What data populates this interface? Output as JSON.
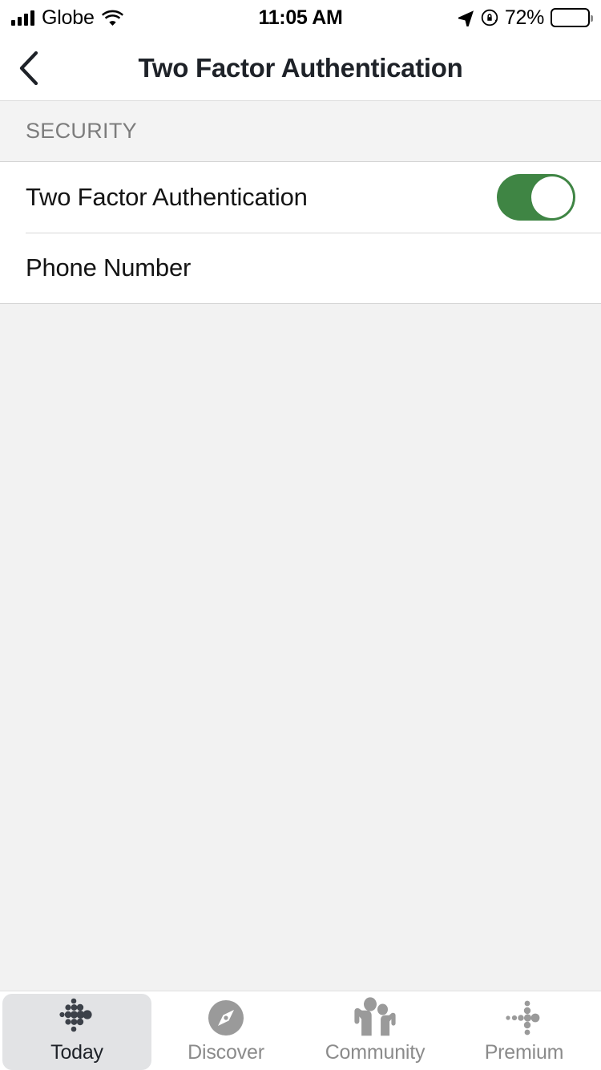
{
  "status_bar": {
    "carrier": "Globe",
    "signal_icon": "signal-bars-icon",
    "wifi_icon": "wifi-icon",
    "time": "11:05 AM",
    "location_icon": "location-arrow-icon",
    "rotation_lock_icon": "rotation-lock-icon",
    "battery_percent": "72%",
    "battery_icon": "battery-icon",
    "battery_level": 72
  },
  "nav_bar": {
    "back_icon": "chevron-left-icon",
    "title": "Two Factor Authentication"
  },
  "section": {
    "header": "SECURITY",
    "rows": [
      {
        "label": "Two Factor Authentication",
        "control": "toggle",
        "toggle_on": true
      },
      {
        "label": "Phone Number",
        "control": "none"
      }
    ]
  },
  "tab_bar": {
    "tabs": [
      {
        "label": "Today",
        "icon": "fitbit-dots-icon",
        "active": true
      },
      {
        "label": "Discover",
        "icon": "compass-icon",
        "active": false
      },
      {
        "label": "Community",
        "icon": "people-group-icon",
        "active": false
      },
      {
        "label": "Premium",
        "icon": "premium-dots-icon",
        "active": false
      }
    ]
  },
  "colors": {
    "toggle_on": "#3f8544",
    "title_text": "#1e2228",
    "section_header_text": "#7c7c7c",
    "page_background": "#f2f2f2",
    "row_background": "#ffffff",
    "tab_active_pill": "#e2e3e5",
    "tab_inactive_text": "#8b8b8b",
    "icon_gray": "#9a9a9a"
  }
}
